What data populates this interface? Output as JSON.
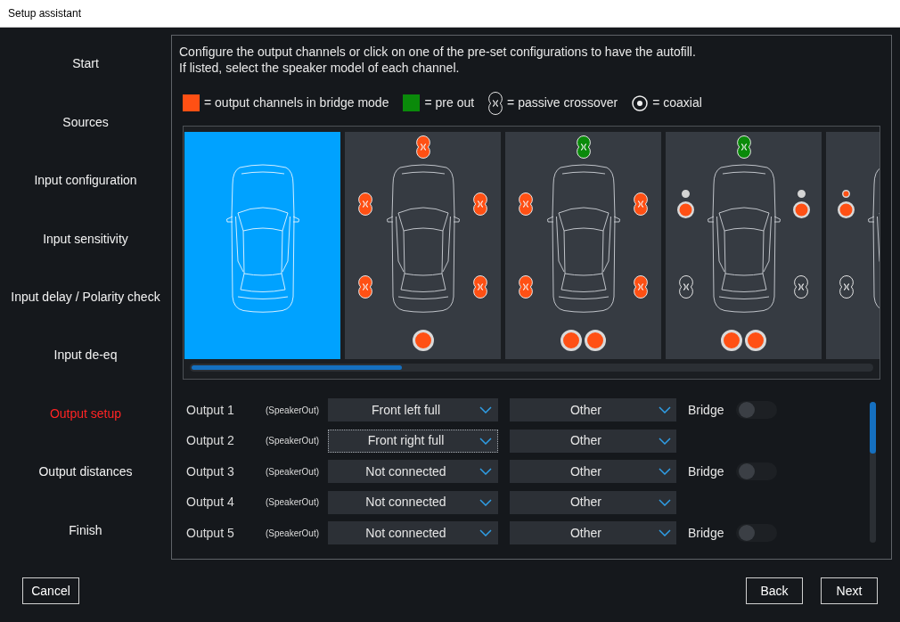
{
  "window": {
    "title": "Setup assistant"
  },
  "sidebar": {
    "items": [
      {
        "label": "Start",
        "selected": false
      },
      {
        "label": "Sources",
        "selected": false
      },
      {
        "label": "Input configuration",
        "selected": false
      },
      {
        "label": "Input sensitivity",
        "selected": false
      },
      {
        "label": "Input delay / Polarity check",
        "selected": false
      },
      {
        "label": "Input de-eq",
        "selected": false
      },
      {
        "label": "Output setup",
        "selected": true
      },
      {
        "label": "Output distances",
        "selected": false
      },
      {
        "label": "Finish",
        "selected": false
      }
    ]
  },
  "instructions": [
    "Configure the output channels or click on one of the pre-set configurations to have the autofill.",
    "If listed, select the speaker model of each channel."
  ],
  "legend": [
    {
      "kind": "swatch",
      "color": "#ff5014",
      "label": "= output channels in bridge mode"
    },
    {
      "kind": "swatch",
      "color": "#0a8a0a",
      "label": "= pre out"
    },
    {
      "kind": "crossover",
      "label": "= passive crossover"
    },
    {
      "kind": "coaxial",
      "label": "= coaxial"
    }
  ],
  "presets": [
    {
      "selected": true
    },
    {
      "selected": false,
      "speakers": {
        "center": [
          {
            "kind": "crossover",
            "color": "#ff5014"
          }
        ],
        "front_left": [
          {
            "kind": "crossover",
            "color": "#ff5014"
          }
        ],
        "front_right": [
          {
            "kind": "crossover",
            "color": "#ff5014"
          }
        ],
        "rear_left": [
          {
            "kind": "crossover",
            "color": "#ff5014"
          }
        ],
        "rear_right": [
          {
            "kind": "crossover",
            "color": "#ff5014"
          }
        ],
        "sub": [
          {
            "kind": "subwoofer",
            "color": "#ff5014"
          }
        ]
      }
    },
    {
      "selected": false,
      "speakers": {
        "center": [
          {
            "kind": "crossover",
            "color": "#0a8a0a"
          }
        ],
        "front_left": [
          {
            "kind": "crossover",
            "color": "#ff5014"
          }
        ],
        "front_right": [
          {
            "kind": "crossover",
            "color": "#ff5014"
          }
        ],
        "rear_left": [
          {
            "kind": "crossover",
            "color": "#ff5014"
          }
        ],
        "rear_right": [
          {
            "kind": "crossover",
            "color": "#ff5014"
          }
        ],
        "sub": [
          {
            "kind": "subwoofer",
            "color": "#ff5014"
          },
          {
            "kind": "subwoofer",
            "color": "#ff5014"
          }
        ]
      }
    },
    {
      "selected": false,
      "speakers": {
        "center": [
          {
            "kind": "crossover",
            "color": "#0a8a0a"
          }
        ],
        "front_left": [
          {
            "kind": "tweeter",
            "color": "#d4d4d4"
          },
          {
            "kind": "woofer",
            "color": "#ff5014"
          }
        ],
        "front_right": [
          {
            "kind": "tweeter",
            "color": "#d4d4d4"
          },
          {
            "kind": "woofer",
            "color": "#ff5014"
          }
        ],
        "rear_left": [
          {
            "kind": "crossover"
          }
        ],
        "rear_right": [
          {
            "kind": "crossover"
          }
        ],
        "sub": [
          {
            "kind": "subwoofer",
            "color": "#ff5014"
          },
          {
            "kind": "subwoofer",
            "color": "#ff5014"
          }
        ]
      }
    },
    {
      "selected": false,
      "speakers": {
        "front_left": [
          {
            "kind": "tweeter",
            "color": "#ff5014"
          },
          {
            "kind": "woofer",
            "color": "#ff5014"
          }
        ],
        "rear_left": [
          {
            "kind": "crossover"
          }
        ]
      }
    }
  ],
  "outputs": [
    {
      "label": "Output 1",
      "type": "(SpeakerOut)",
      "channel": {
        "value": "Front left full",
        "focused": false
      },
      "model": {
        "value": "Other"
      },
      "bridge": {
        "label": "Bridge",
        "on": false
      }
    },
    {
      "label": "Output 2",
      "type": "(SpeakerOut)",
      "channel": {
        "value": "Front right full",
        "focused": true
      },
      "model": {
        "value": "Other"
      }
    },
    {
      "label": "Output 3",
      "type": "(SpeakerOut)",
      "channel": {
        "value": "Not connected",
        "focused": false
      },
      "model": {
        "value": "Other"
      },
      "bridge": {
        "label": "Bridge",
        "on": false
      }
    },
    {
      "label": "Output 4",
      "type": "(SpeakerOut)",
      "channel": {
        "value": "Not connected",
        "focused": false
      },
      "model": {
        "value": "Other"
      }
    },
    {
      "label": "Output 5",
      "type": "(SpeakerOut)",
      "channel": {
        "value": "Not connected",
        "focused": false
      },
      "model": {
        "value": "Other"
      },
      "bridge": {
        "label": "Bridge",
        "on": false
      }
    }
  ],
  "cancel_button": "Cancel",
  "nav_buttons": [
    "Back",
    "Next"
  ]
}
